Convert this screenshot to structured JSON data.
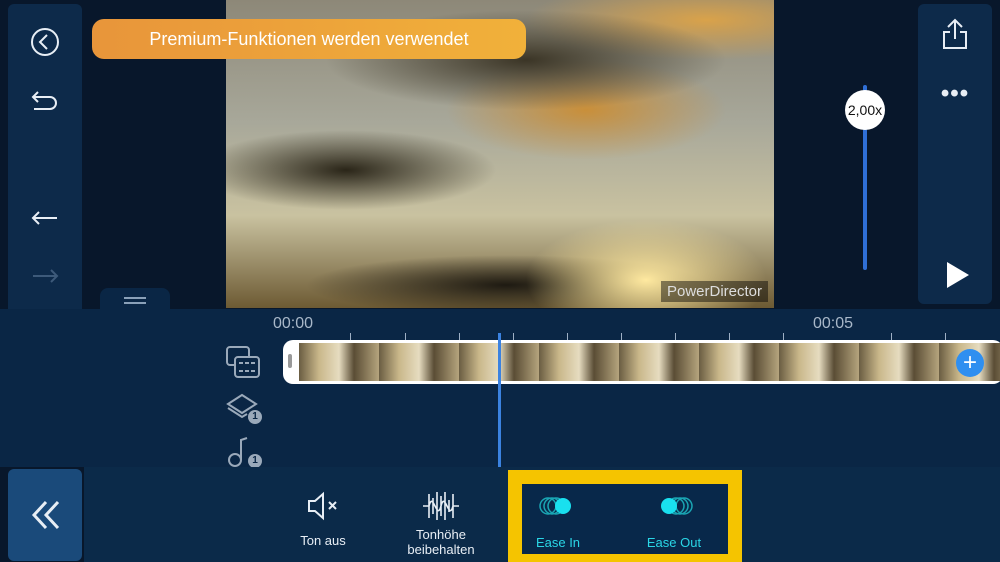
{
  "banner": "Premium-Funktionen werden verwendet",
  "watermark": "PowerDirector",
  "speed": "2,00x",
  "timeline": {
    "time_start": "00:00",
    "time_mid": "00:05",
    "overlay_count": "1",
    "audio_count": "1"
  },
  "toolbar": {
    "mute": "Ton aus",
    "pitch": "Tonhöhe beibehalten",
    "ease_in": "Ease In",
    "ease_out": "Ease Out"
  },
  "colors": {
    "accent": "#19d8e8",
    "highlight": "#f5c400",
    "playhead": "#3b82e0",
    "banner": "#eba23a"
  }
}
